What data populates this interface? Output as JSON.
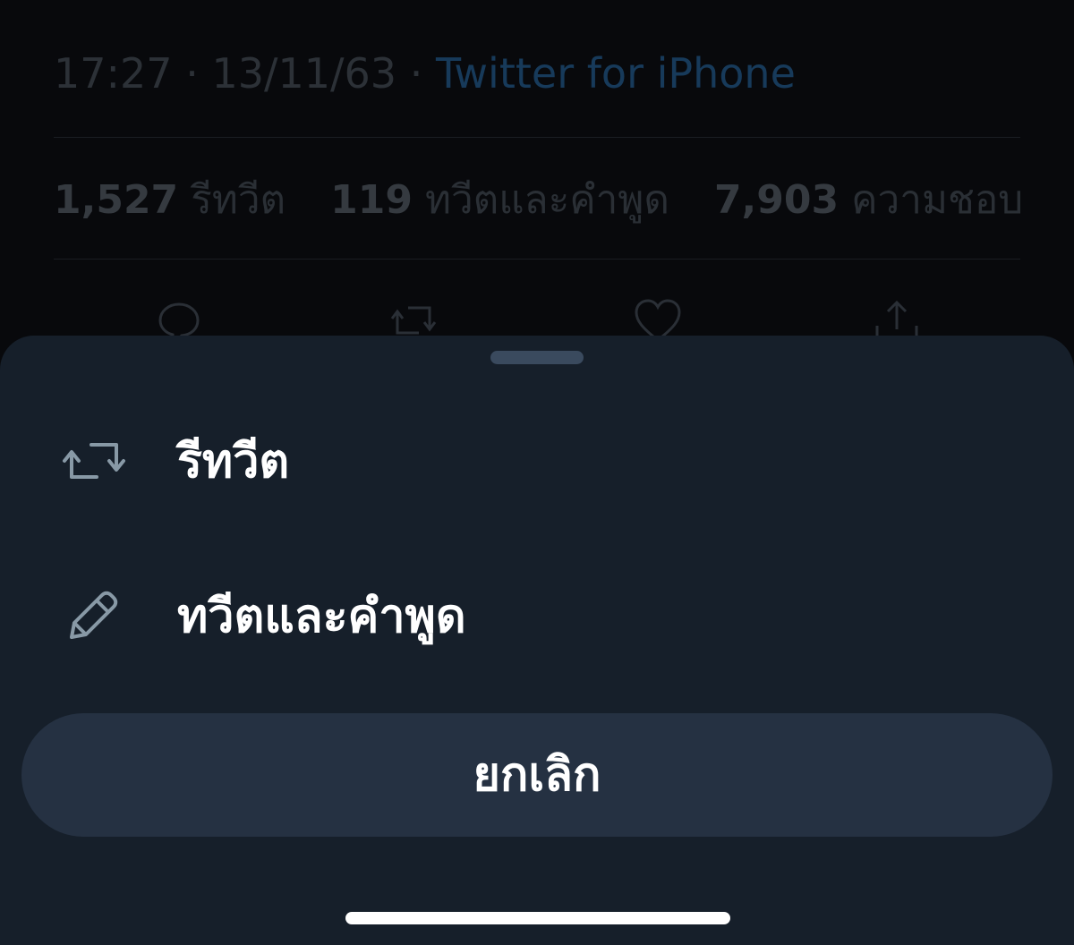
{
  "tweet": {
    "time": "17:27",
    "date": "13/11/63",
    "separator": "·",
    "source": "Twitter for iPhone",
    "stats": [
      {
        "count": "1,527",
        "label": "รีทวีต"
      },
      {
        "count": "119",
        "label": "ทวีตและคำพูด"
      },
      {
        "count": "7,903",
        "label": "ความชอบ"
      }
    ],
    "action_icons": [
      "reply-icon",
      "retweet-icon",
      "like-icon",
      "share-icon"
    ]
  },
  "sheet": {
    "items": [
      {
        "icon": "retweet-icon",
        "label": "รีทวีต"
      },
      {
        "icon": "pencil-icon",
        "label": "ทวีตและคำพูด"
      }
    ],
    "cancel_label": "ยกเลิก"
  },
  "colors": {
    "sheet_bg": "#161f2a",
    "cancel_bg": "#253142",
    "link": "#1d9bf0",
    "text": "#ffffff"
  }
}
